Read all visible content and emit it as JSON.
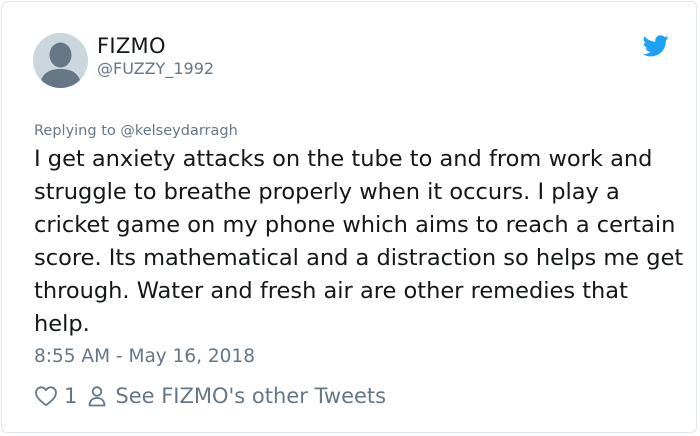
{
  "tweet": {
    "display_name": "FIZMO",
    "handle": "@FUZZY_1992",
    "replying_to": "Replying to @kelseydarragh",
    "text": "I get anxiety attacks on the tube to and from work and struggle to breathe properly when it occurs. I play a cricket game on my phone which aims to reach a certain score. Its mathematical and a distraction so helps me get through. Water and fresh air are other remedies that help.",
    "timestamp": "8:55 AM - May 16, 2018",
    "like_count": "1",
    "other_tweets_link": "See FIZMO's other Tweets"
  },
  "icons": {
    "avatar": "default-profile-avatar",
    "brand": "twitter-bird-icon",
    "like": "heart-icon",
    "profile": "person-icon"
  },
  "colors": {
    "brand_blue": "#1da1f2",
    "text_primary": "#14171a",
    "text_secondary": "#657786",
    "border": "#e1e8ed",
    "avatar_bg": "#ccd6dd"
  }
}
